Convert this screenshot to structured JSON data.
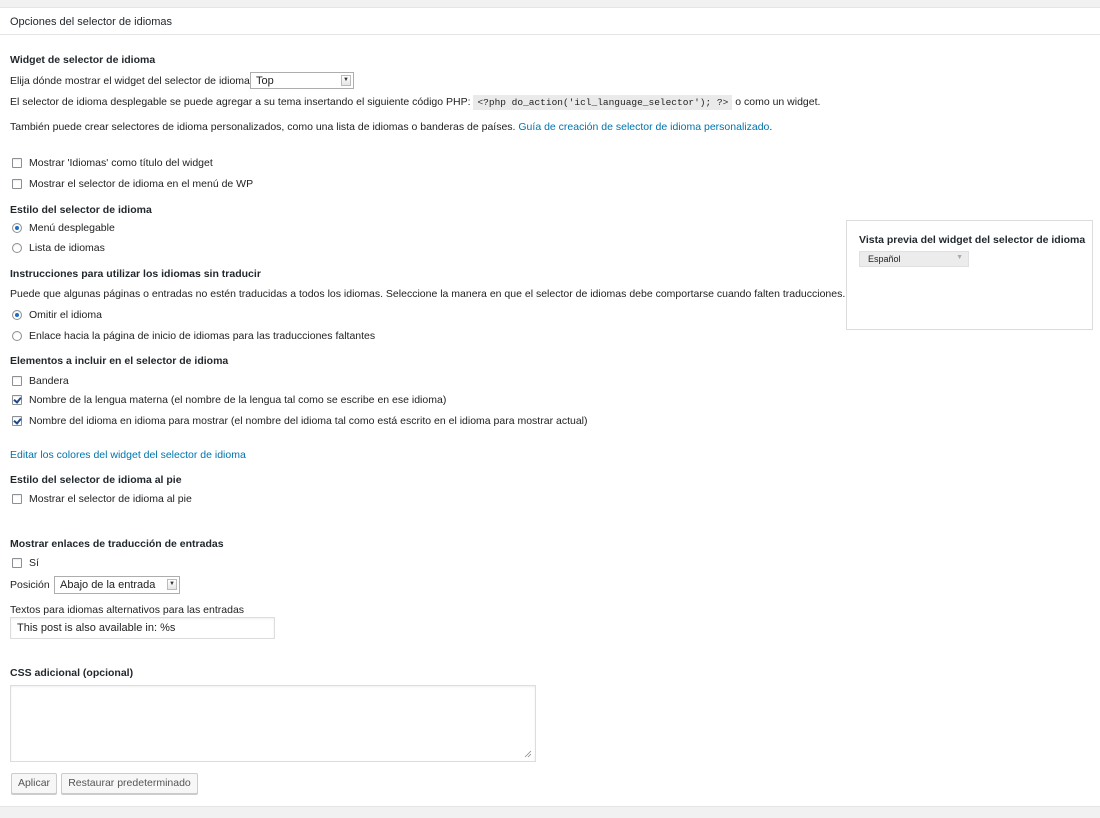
{
  "panel_title": "Opciones del selector de idiomas",
  "widget": {
    "heading": "Widget de selector de idioma",
    "position_label": "Elija dónde mostrar el widget del selector de idioma:",
    "position_value": "Top",
    "php_text_before": "El selector de idioma desplegable se puede agregar a su tema insertando el siguiente código PHP:",
    "php_code": "<?php do_action('icl_language_selector'); ?>",
    "php_text_after": "o como un widget.",
    "custom_text": "También puede crear selectores de idioma personalizados, como una lista de idiomas o banderas de países.",
    "custom_link": "Guía de creación de selector de idioma personalizado",
    "period": "."
  },
  "options": {
    "show_title": "Mostrar 'Idiomas' como título del widget",
    "show_in_menu": "Mostrar el selector de idioma en el menú de WP"
  },
  "style": {
    "heading": "Estilo del selector de idioma",
    "dropdown": "Menú desplegable",
    "list": "Lista de idiomas"
  },
  "untranslated": {
    "heading": "Instrucciones para utilizar los idiomas sin traducir",
    "description": "Puede que algunas páginas o entradas no estén traducidas a todos los idiomas. Seleccione la manera en que el selector de idiomas debe comportarse cuando falten traducciones.",
    "skip": "Omitir el idioma",
    "link_home": "Enlace hacia la página de inicio de idiomas para las traducciones faltantes"
  },
  "elements": {
    "heading": "Elementos a incluir en el selector de idioma",
    "flag": "Bandera",
    "native_name": "Nombre de la lengua materna (el nombre de la lengua tal como se escribe en ese idioma)",
    "display_name": "Nombre del idioma en idioma para mostrar (el nombre del idioma tal como está escrito en el idioma para mostrar actual)"
  },
  "edit_colors_link": "Editar los colores del widget del selector de idioma",
  "footer": {
    "heading": "Estilo del selector de idioma al pie",
    "show": "Mostrar el selector de idioma al pie"
  },
  "post_links": {
    "heading": "Mostrar enlaces de traducción de entradas",
    "yes": "Sí",
    "position_label": "Posición",
    "position_value": "Abajo de la entrada",
    "alt_text_label": "Textos para idiomas alternativos para las entradas",
    "alt_text_value": "This post is also available in: %s"
  },
  "css": {
    "heading": "CSS adicional (opcional)",
    "value": ""
  },
  "buttons": {
    "apply": "Aplicar",
    "reset": "Restaurar predeterminado"
  },
  "preview": {
    "title": "Vista previa del widget del selector de idioma",
    "selected": "Español"
  },
  "colors": {
    "link": "#0073aa",
    "radio_selected": "#1e6ec8",
    "check": "#1e4a8c"
  }
}
